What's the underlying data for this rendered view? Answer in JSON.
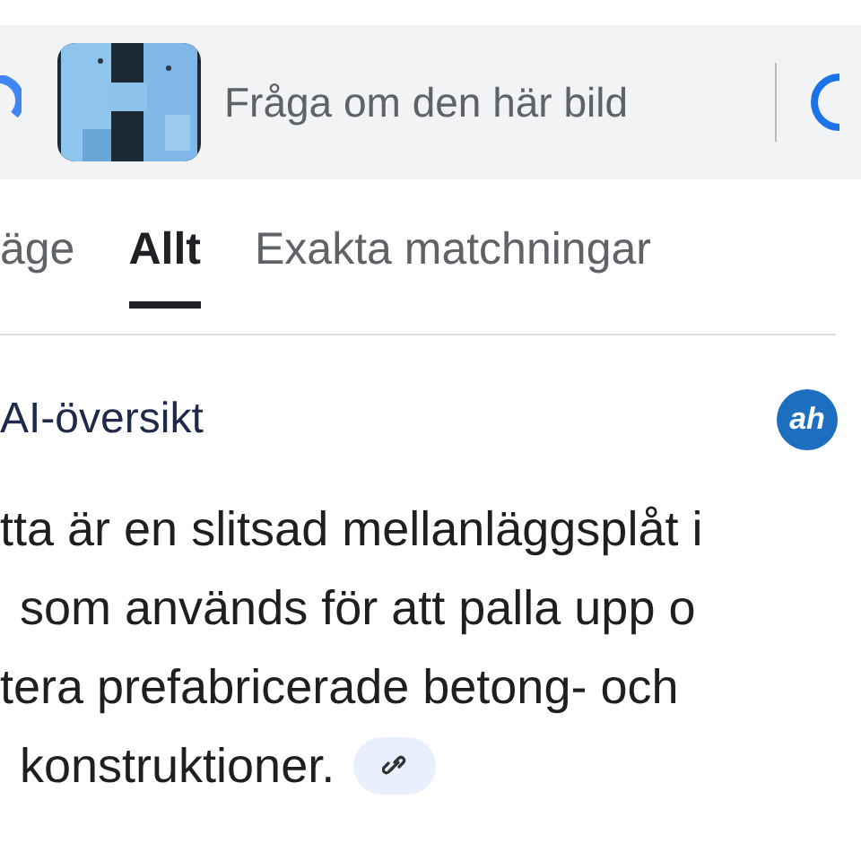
{
  "search_bar": {
    "placeholder": "Fråga om den här bild"
  },
  "tabs": [
    {
      "label": "äge",
      "selected": false
    },
    {
      "label": "Allt",
      "selected": true
    },
    {
      "label": "Exakta matchningar",
      "selected": false
    }
  ],
  "ai_overview": {
    "title": "AI-översikt",
    "source_logo": "ah",
    "lines": [
      "tta är en slitsad mellanläggsplåt i",
      "som används för att palla upp o",
      "tera prefabricerade betong- och",
      "konstruktioner."
    ]
  }
}
